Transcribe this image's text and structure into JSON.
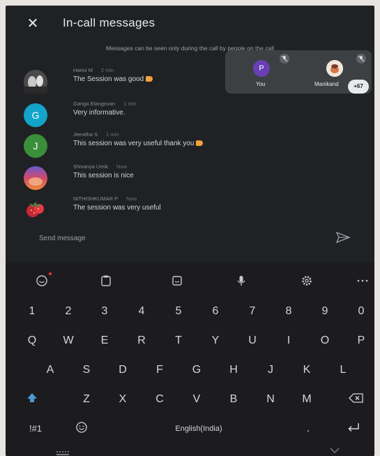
{
  "header": {
    "close_label": "✕",
    "title": "In-call messages"
  },
  "notice": "Messages can be seen only during the call by people on the call",
  "messages": [
    {
      "sender": "Harini M",
      "time": "2 min",
      "text": "The Session was good",
      "avatar_letter": "",
      "avatar_color": "#6b6b6b"
    },
    {
      "sender": "Ganga Elangovan",
      "time": "1 min",
      "text": "Very informative.",
      "avatar_letter": "G",
      "avatar_color": "#12a5c9"
    },
    {
      "sender": "Jeevitha S",
      "time": "1 min",
      "text": "This session was very useful thank you",
      "avatar_letter": "J",
      "avatar_color": "#3a8f3a"
    },
    {
      "sender": "Shivanya Umik",
      "time": "Now",
      "text": "This session is nice",
      "avatar_letter": "",
      "avatar_color": "#d14a6a"
    },
    {
      "sender": "NITHISHKUMAR P",
      "time": "Now",
      "text": "The session was very useful",
      "avatar_letter": "",
      "avatar_color": "#b02b3a"
    }
  ],
  "participants": {
    "self": {
      "letter": "P",
      "name": "You",
      "color": "#6a3fb5"
    },
    "other": {
      "name": "Manikand",
      "color": "#f0e6dc"
    },
    "more_count": "+67"
  },
  "send": {
    "placeholder": "Send message"
  },
  "keyboard": {
    "numbers": [
      "1",
      "2",
      "3",
      "4",
      "5",
      "6",
      "7",
      "8",
      "9",
      "0"
    ],
    "row1": [
      "Q",
      "W",
      "E",
      "R",
      "T",
      "Y",
      "U",
      "I",
      "O",
      "P"
    ],
    "row2": [
      "A",
      "S",
      "D",
      "F",
      "G",
      "H",
      "J",
      "K",
      "L"
    ],
    "row3": [
      "Z",
      "X",
      "C",
      "V",
      "B",
      "N",
      "M"
    ],
    "symbols_label": "!#1",
    "space_label": "English(India)",
    "period_label": "."
  },
  "colors": {
    "accent": "#4a9ad4",
    "surface": "#202124",
    "keyboard_bg": "#1c1c1e"
  }
}
